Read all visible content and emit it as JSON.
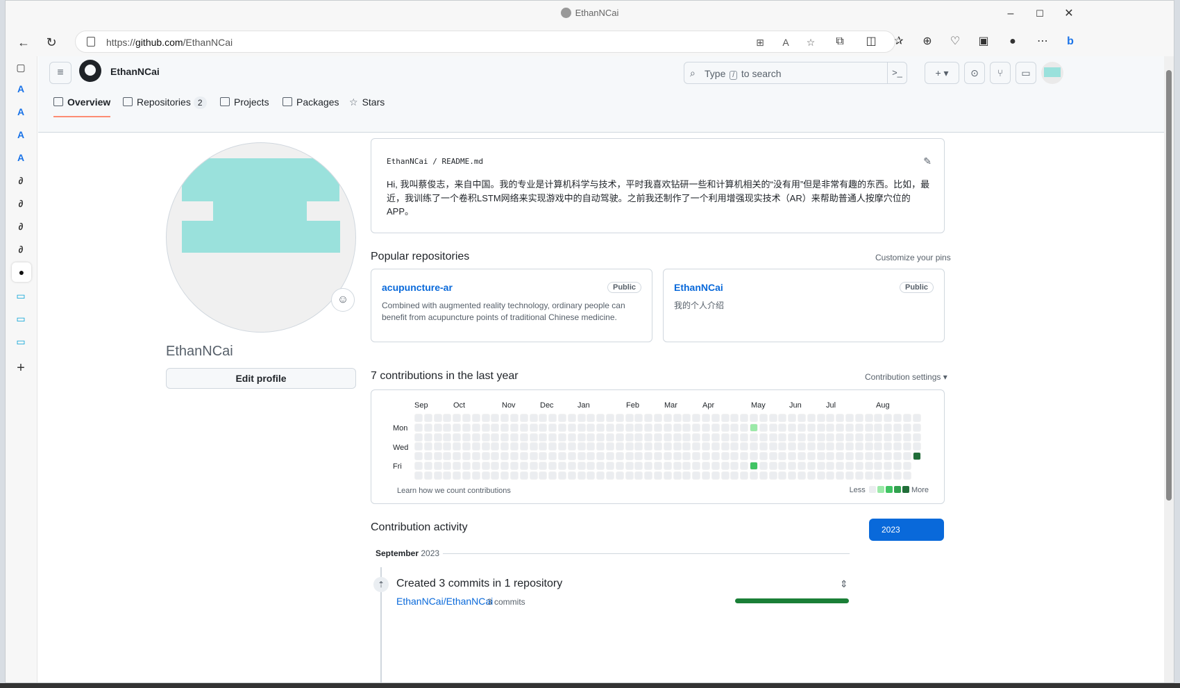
{
  "window": {
    "title": "EthanNCai"
  },
  "browser": {
    "url_prefix": "https://",
    "url_domain": "github.com",
    "url_path": "/EthanNCai"
  },
  "header": {
    "username": "EthanNCai",
    "search_prefix": "Type",
    "search_slash": "/",
    "search_suffix": "to search",
    "plus": "+ ▾"
  },
  "tabs": [
    {
      "label": "Overview"
    },
    {
      "label": "Repositories",
      "count": "2"
    },
    {
      "label": "Projects"
    },
    {
      "label": "Packages"
    },
    {
      "label": "Stars"
    }
  ],
  "profile": {
    "name": "EthanNCai",
    "edit_label": "Edit profile"
  },
  "readme": {
    "owner": "EthanNCai",
    "sep": "/",
    "file": "README.md",
    "text": "Hi, 我叫蔡俊志，来自中国。我的专业是计算机科学与技术，平时我喜欢钻研一些和计算机相关的“没有用”但是非常有趣的东西。比如，最近，我训练了一个卷积LSTM网络来实现游戏中的自动驾驶。之前我还制作了一个利用增强现实技术（AR）来帮助普通人按摩穴位的APP。"
  },
  "popular": {
    "title": "Popular repositories",
    "customize": "Customize your pins",
    "repos": [
      {
        "name": "acupuncture-ar",
        "badge": "Public",
        "desc": "Combined with augmented reality technology, ordinary people can benefit from acupuncture points of traditional Chinese medicine."
      },
      {
        "name": "EthanNCai",
        "badge": "Public",
        "desc": "我的个人介绍"
      }
    ]
  },
  "contributions": {
    "title": "7 contributions in the last year",
    "settings": "Contribution settings ▾",
    "months": [
      "Sep",
      "Oct",
      "Nov",
      "Dec",
      "Jan",
      "Feb",
      "Mar",
      "Apr",
      "May",
      "Jun",
      "Jul",
      "Aug"
    ],
    "days": [
      "Mon",
      "Wed",
      "Fri"
    ],
    "learn": "Learn how we count contributions",
    "less": "Less",
    "more": "More",
    "colors": [
      "#ebedf0",
      "#9be9a8",
      "#40c463",
      "#30a14e",
      "#216e39"
    ]
  },
  "activity": {
    "title": "Contribution activity",
    "year": "2023",
    "month": "September",
    "month_year": "2023",
    "entry_title": "Created 3 commits in 1 repository",
    "repo": "EthanNCai/EthanNCai",
    "commits": "3 commits",
    "commit_share": 1.0
  }
}
